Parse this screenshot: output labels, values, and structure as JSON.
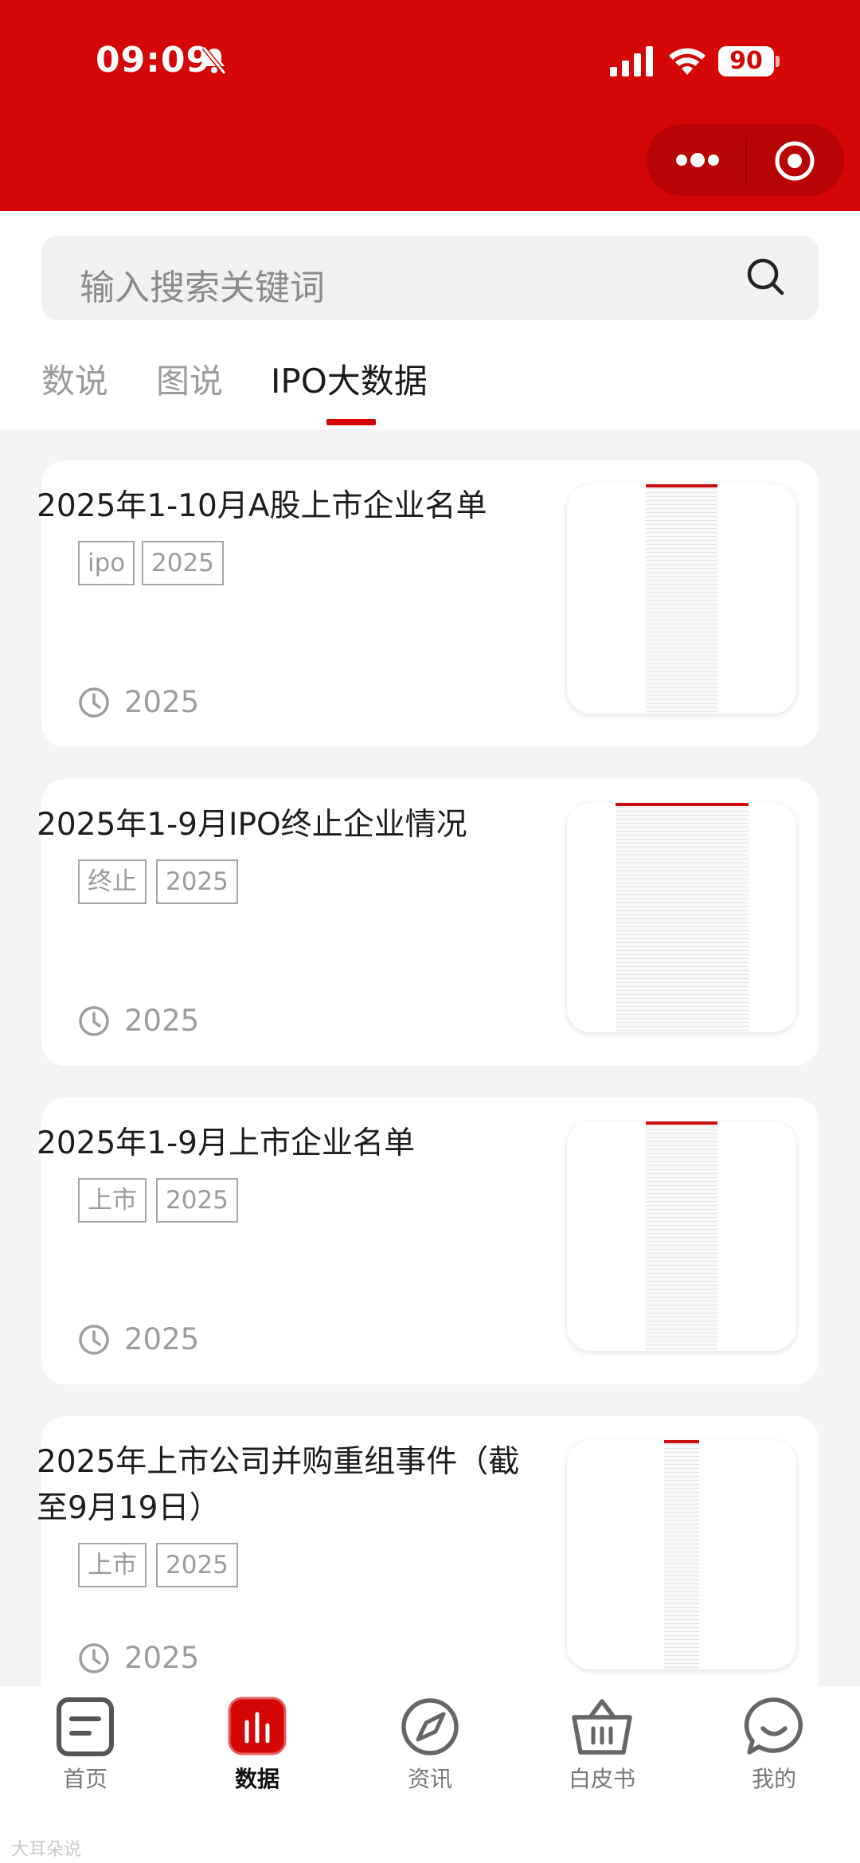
{
  "status_bar": {
    "time": "09:09",
    "battery": "90"
  },
  "capsule": {
    "more_icon": "more-dots-icon",
    "close_icon": "record-circle-icon"
  },
  "search": {
    "placeholder": "输入搜索关键词",
    "icon": "search-icon"
  },
  "tabs": [
    {
      "label": "数说",
      "active": false
    },
    {
      "label": "图说",
      "active": false
    },
    {
      "label": "IPO大数据",
      "active": true
    }
  ],
  "cards": [
    {
      "title": "2025年1-10月A股上市企业名单",
      "tags": [
        "ipo",
        "2025"
      ],
      "date": "2025"
    },
    {
      "title": "2025年1-9月IPO终止企业情况",
      "tags": [
        "终止",
        "2025"
      ],
      "date": "2025"
    },
    {
      "title": "2025年1-9月上市企业名单",
      "tags": [
        "上市",
        "2025"
      ],
      "date": "2025"
    },
    {
      "title": "2025年上市公司并购重组事件（截至9月19日）",
      "tags": [
        "上市",
        "2025"
      ],
      "date": "2025"
    }
  ],
  "tab_bar": [
    {
      "label": "首页",
      "icon": "home-doc-icon",
      "active": false
    },
    {
      "label": "数据",
      "icon": "bar-chart-icon",
      "active": true
    },
    {
      "label": "资讯",
      "icon": "compass-icon",
      "active": false
    },
    {
      "label": "白皮书",
      "icon": "basket-icon",
      "active": false
    },
    {
      "label": "我的",
      "icon": "smile-chat-icon",
      "active": false
    }
  ],
  "watermark": "大耳朵说",
  "colors": {
    "brand": "#d40606",
    "capsule": "#b80404",
    "text_muted": "#9b9b9b"
  }
}
